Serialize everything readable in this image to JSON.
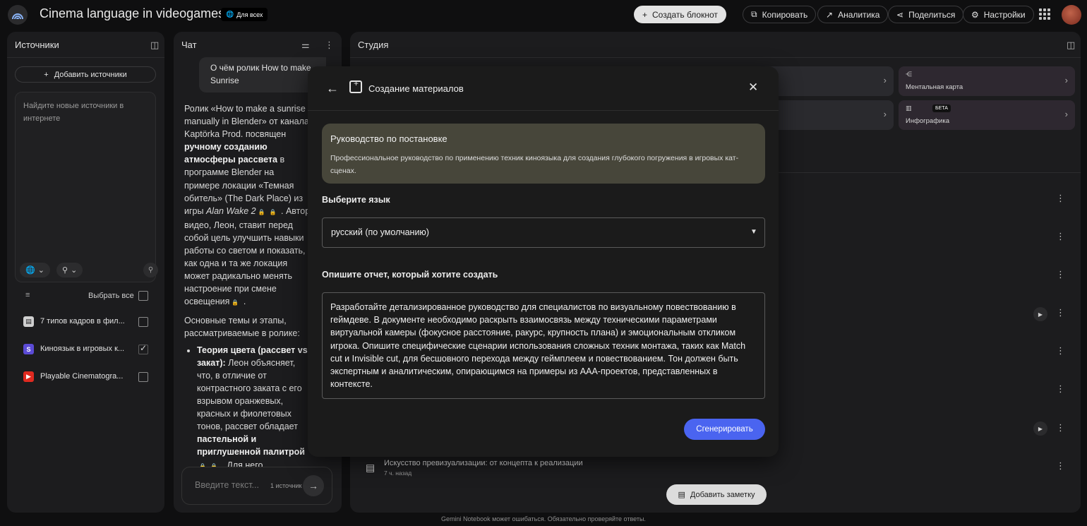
{
  "header": {
    "title": "Cinema language in videogames",
    "share_badge": "Для всех",
    "create_notebook": "Создать блокнот",
    "copy": "Копировать",
    "analytics": "Аналитика",
    "share": "Поделиться",
    "settings": "Настройки"
  },
  "sources": {
    "title": "Источники",
    "add_button": "Добавить источники",
    "search_placeholder": "Найдите новые источники в интернете",
    "select_all": "Выбрать все",
    "items": [
      {
        "label": "7 типов кадров в фил...",
        "checked": false,
        "icon": "doc-icon",
        "color": "#c8c8c8"
      },
      {
        "label": "Киноязык в игровых к...",
        "checked": true,
        "icon": "s-icon",
        "color": "#5b4bd6"
      },
      {
        "label": "Playable Cinematogra...",
        "checked": false,
        "icon": "youtube-icon",
        "color": "#e02a20"
      }
    ]
  },
  "chat": {
    "title": "Чат",
    "user_question": "О чём ролик How to make Sunrise",
    "answer": {
      "p1_a": "Ролик «How to make a sunrise manually in Blender» от канала Kaptörka Prod. посвящен ",
      "p1_b": "ручному созданию атмосферы рассвета",
      "p1_c": " в программе Blender на примере локации «Темная обитель» (The Dark Place) из игры ",
      "p1_d": "Alan Wake 2",
      "p1_e": " . Автор видео, Леон, ставит перед собой цель улучшить навыки работы со светом и показать, как одна и та же локация может радикально менять настроение при смене освещения",
      "p1_f": " .",
      "p2": "Основные темы и этапы, рассматриваемые в ролике:",
      "li_head": "Теория цвета (рассвет vs закат):",
      "li_a": " Леон объясняет, что, в отличие от контрастного заката с его взрывом оранжевых, красных и фиолетовых тонов, рассвет обладает ",
      "li_b": "пастельной и приглушенной палитрой",
      "li_c": " . Для него"
    },
    "input_placeholder": "Введите текст...",
    "source_count": "1 источник"
  },
  "studio": {
    "title": "Студия",
    "tiles": [
      {
        "label": "Ментальная карта",
        "beta": ""
      },
      {
        "label": "Инфографика",
        "beta": "БЕТА"
      }
    ],
    "note": {
      "title": "Искусство превизуализации: от концепта к реализации",
      "time": "7 ч. назад"
    },
    "add_note": "Добавить заметку"
  },
  "modal": {
    "title": "Создание материалов",
    "format_title": "Руководство по постановке",
    "format_desc": "Профессиональное руководство по применению техник киноязыка для создания глубокого погружения в игровых кат-сценах.",
    "lang_label": "Выберите язык",
    "lang_value": "русский (по умолчанию)",
    "desc_label": "Опишите отчет, который хотите создать",
    "desc_value": "Разработайте детализированное руководство для специалистов по визуальному повествованию в геймдеве. В документе необходимо раскрыть взаимосвязь между техническими параметрами виртуальной камеры (фокусное расстояние, ракурс, крупность плана) и эмоциональным откликом игрока. Опишите специфические сценарии использования сложных техник монтажа, таких как Match cut и Invisible cut, для бесшовного перехода между геймплеем и повествованием. Тон должен быть экспертным и аналитическим, опирающимся на примеры из AAA-проектов, представленных в контексте.",
    "generate": "Сгенерировать"
  },
  "footer": "Gemini Notebook может ошибаться. Обязательно проверяйте ответы.",
  "colors": {
    "accent": "#4a64f0",
    "format_card": "#47463a",
    "background": "#0f0f10"
  }
}
